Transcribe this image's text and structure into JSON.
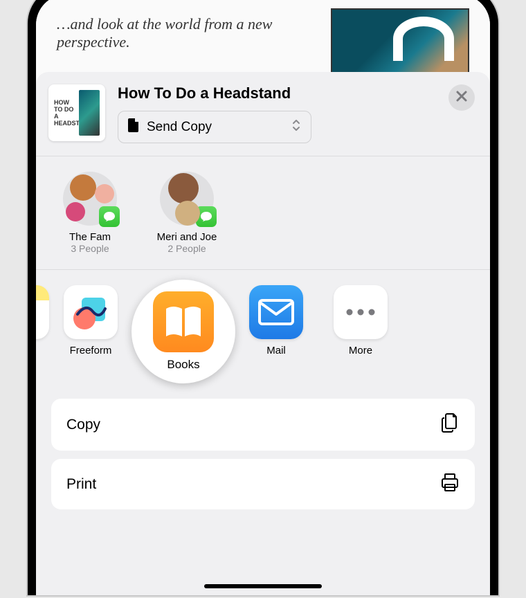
{
  "background": {
    "text": "…and look at the world from a new perspective."
  },
  "shareSheet": {
    "title": "How To Do a Headstand",
    "thumbTitle": "HOW TO DO A HEADSTAND",
    "sendMode": "Send Copy"
  },
  "contacts": [
    {
      "name": "The Fam",
      "subtitle": "3 People"
    },
    {
      "name": "Meri and Joe",
      "subtitle": "2 People"
    }
  ],
  "apps": {
    "freeform": "Freeform",
    "books": "Books",
    "mail": "Mail",
    "more": "More"
  },
  "actions": {
    "copy": "Copy",
    "print": "Print"
  }
}
